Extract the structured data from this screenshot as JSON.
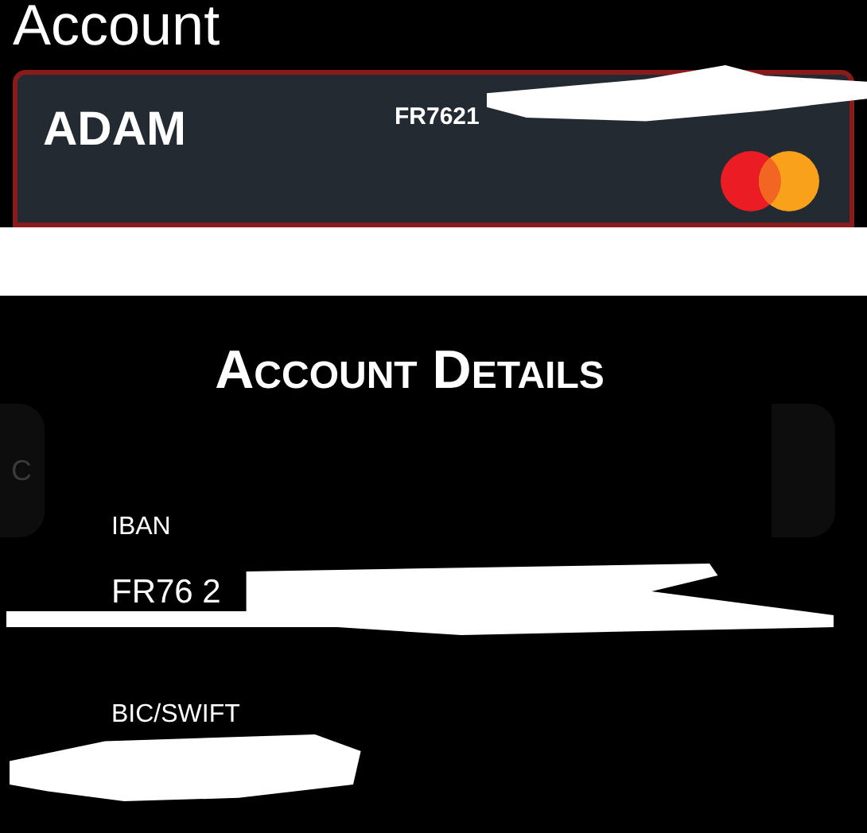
{
  "header": {
    "title": "Account"
  },
  "card": {
    "holder": "ADAM",
    "number": "FR7621"
  },
  "background_button": {
    "label": "C"
  },
  "dialog": {
    "title": "Account Details",
    "fields": [
      {
        "label": "IBAN",
        "value": "FR76 2"
      },
      {
        "label": "BIC/SWIFT"
      }
    ]
  }
}
